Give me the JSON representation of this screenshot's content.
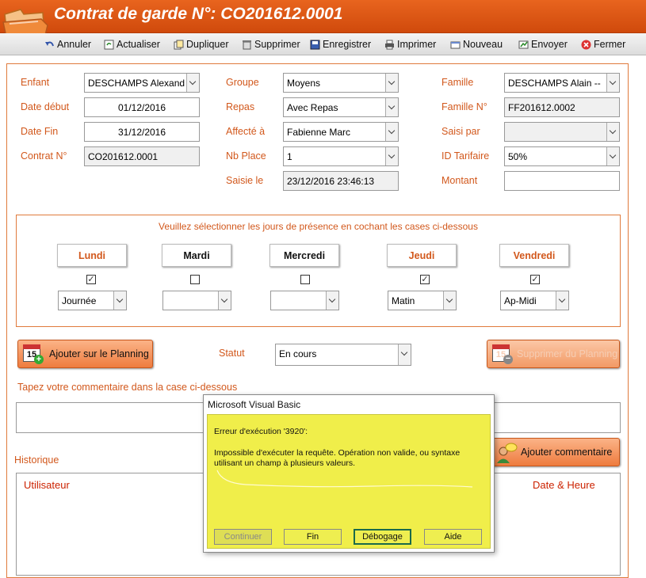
{
  "window": {
    "title": "Contrat de garde N°: CO201612.0001"
  },
  "toolbar": {
    "items": [
      {
        "label": "Annuler",
        "icon": "undo-icon"
      },
      {
        "label": "Actualiser",
        "icon": "refresh-icon"
      },
      {
        "label": "Dupliquer",
        "icon": "duplicate-icon"
      },
      {
        "label": "Supprimer",
        "icon": "delete-icon"
      },
      {
        "label": "Enregistrer",
        "icon": "save-icon"
      },
      {
        "label": "Imprimer",
        "icon": "print-icon"
      },
      {
        "label": "Nouveau",
        "icon": "new-icon"
      },
      {
        "label": "Envoyer",
        "icon": "send-icon"
      },
      {
        "label": "Fermer",
        "icon": "close-icon"
      }
    ]
  },
  "form": {
    "enfant_label": "Enfant",
    "enfant_value": "DESCHAMPS Alexand",
    "date_debut_label": "Date début",
    "date_debut_value": "01/12/2016",
    "date_fin_label": "Date Fin",
    "date_fin_value": "31/12/2016",
    "contrat_label": "Contrat N°",
    "contrat_value": "CO201612.0001",
    "groupe_label": "Groupe",
    "groupe_value": "Moyens",
    "repas_label": "Repas",
    "repas_value": "Avec Repas",
    "affecte_label": "Affecté à",
    "affecte_value": "Fabienne Marc",
    "nbplace_label": "Nb Place",
    "nbplace_value": "1",
    "saisie_le_label": "Saisie le",
    "saisie_le_value": "23/12/2016 23:46:13",
    "famille_label": "Famille",
    "famille_value": "DESCHAMPS Alain --",
    "famille_no_label": "Famille N°",
    "famille_no_value": "FF201612.0002",
    "saisi_par_label": "Saisi par",
    "saisi_par_value": "",
    "tarifaire_label": "ID Tarifaire",
    "tarifaire_value": "50%",
    "montant_label": "Montant",
    "montant_value": ""
  },
  "days": {
    "instruction": "Veuillez sélectionner les jours de présence en cochant les cases ci-dessous",
    "items": [
      {
        "label": "Lundi",
        "checked": true,
        "check": "✓",
        "value": "Journée",
        "color": "#d2581c"
      },
      {
        "label": "Mardi",
        "checked": false,
        "check": "",
        "value": "",
        "color": "#111111"
      },
      {
        "label": "Mercredi",
        "checked": false,
        "check": "",
        "value": "",
        "color": "#111111"
      },
      {
        "label": "Jeudi",
        "checked": true,
        "check": "✓",
        "value": "Matin",
        "color": "#d2581c"
      },
      {
        "label": "Vendredi",
        "checked": true,
        "check": "✓",
        "value": "Ap-Midi",
        "color": "#d2581c"
      }
    ]
  },
  "planning": {
    "add_label": "Ajouter sur le Planning",
    "remove_label": "Supprimer du Planning",
    "calendar_day": "15",
    "statut_label": "Statut",
    "statut_value": "En cours"
  },
  "comment": {
    "instruction": "Tapez votre commentaire dans la case ci-dessous",
    "value": "",
    "add_label": "Ajouter commentaire"
  },
  "history": {
    "title": "Historique",
    "col_user": "Utilisateur",
    "col_date": "Date & Heure"
  },
  "dialog": {
    "title": "Microsoft Visual Basic",
    "error_title": "Erreur d'exécution '3920':",
    "message": "Impossible d'exécuter la requête. Opération non valide, ou syntaxe utilisant un champ à plusieurs valeurs.",
    "buttons": {
      "continue": "Continuer",
      "end": "Fin",
      "debug": "Débogage",
      "help": "Aide"
    }
  },
  "colors": {
    "accent": "#d2581c",
    "titlebar": "#e0581a",
    "dialog_bg": "#f0ee4a"
  }
}
